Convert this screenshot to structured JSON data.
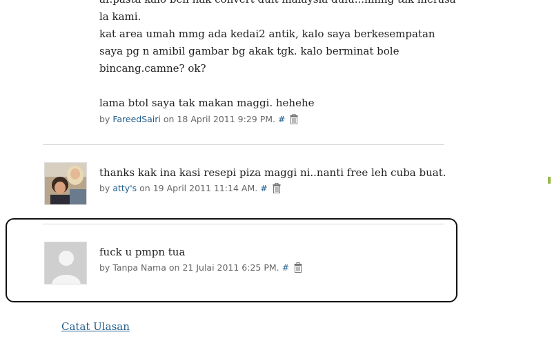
{
  "comments": [
    {
      "lines": [
        "ar.pasta kalo beli nak convert duit malaysia dulu...hmng tak merasa",
        "la kami.",
        "kat area umah mmg ada kedai2 antik, kalo saya berkesempatan",
        "saya pg n amibil gambar bg akak tgk. kalo berminat bole",
        "bincang.camne? ok?",
        "",
        "lama btol saya tak makan maggi. hehehe"
      ],
      "by": "by",
      "author": "FareedSairi",
      "on": "on",
      "date": "18 April 2011 9:29 PM.",
      "hash": "#",
      "delete_icon": "trash-icon"
    },
    {
      "lines": [
        "thanks kak ina kasi resepi piza maggi ni..nanti free leh cuba buat."
      ],
      "by": "by",
      "author": "atty's",
      "on": "on",
      "date": "19 April 2011 11:14 AM.",
      "hash": "#",
      "avatar": "user-photo",
      "delete_icon": "trash-icon"
    },
    {
      "lines": [
        "fuck u pmpn tua"
      ],
      "by": "by",
      "author": "Tanpa Nama",
      "on": "on",
      "date": "21 Julai 2011 6:25 PM.",
      "hash": "#",
      "avatar": "default-avatar",
      "delete_icon": "trash-icon"
    }
  ],
  "post_comment_link": "Catat Ulasan",
  "colors": {
    "link": "#1f5c8b",
    "highlight_border": "#111111",
    "separator": "#d8d8d8"
  }
}
